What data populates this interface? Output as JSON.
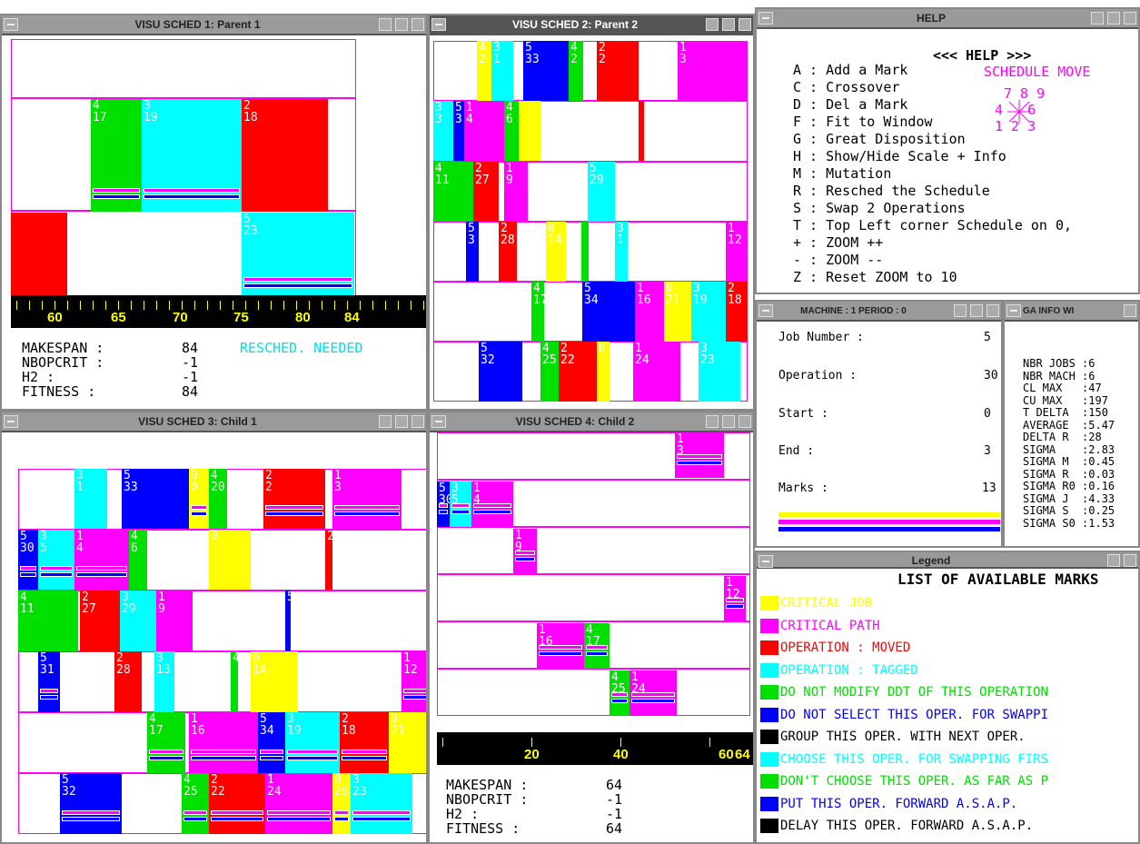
{
  "windows": {
    "w1": "VISU SCHED 1: Parent 1",
    "w2": "VISU SCHED 2: Parent 2",
    "w3": "VISU SCHED 3: Child 1",
    "w4": "VISU SCHED 4: Child 2",
    "help": "HELP",
    "machine": "MACHINE : 1 PERIOD : 0",
    "gainfo": "GA INFO WI",
    "legend": "Legend"
  },
  "s1": {
    "ticks": [
      "60",
      "65",
      "70",
      "75",
      "80",
      "84"
    ],
    "makespan_label": "MAKESPAN :",
    "makespan": "84",
    "nbop_label": "NBOPCRIT :",
    "nbop": "-1",
    "h2_label": "H2 :",
    "h2": "-1",
    "fit_label": "FITNESS :",
    "fit": "84",
    "resched": "RESCHED. NEEDED"
  },
  "s4": {
    "ticks": [
      "20",
      "40",
      "60",
      "64"
    ],
    "makespan_label": "MAKESPAN :",
    "makespan": "64",
    "nbop_label": "NBOPCRIT :",
    "nbop": "-1",
    "h2_label": "H2 :",
    "h2": "-1",
    "fit_label": "FITNESS :",
    "fit": "64"
  },
  "help": {
    "title": "<<< HELP >>>",
    "items": [
      "A : Add a Mark",
      "C : Crossover",
      "D : Del a Mark",
      "F : Fit to Window",
      "G : Great Disposition",
      "H : Show/Hide Scale + Info",
      "M : Mutation",
      "R : Resched the Schedule",
      "S : Swap 2 Operations",
      "T : Top Left corner Schedule on 0,",
      "+ : ZOOM ++",
      "- : ZOOM --",
      "Z : Reset ZOOM to 10"
    ],
    "move_title": "SCHEDULE MOVE",
    "move_row1": "7 8 9",
    "move_row2": "4   6",
    "move_row3": "1 2 3"
  },
  "machine": {
    "job_label": "Job Number :",
    "job": "5",
    "op_label": "Operation :",
    "op": "30",
    "start_label": "Start :",
    "start": "0",
    "end_label": "End :",
    "end": "3",
    "marks_label": "Marks :",
    "marks": "13"
  },
  "gainfo": {
    "lines": [
      "NBR JOBS :6",
      "NBR MACH :6",
      "CL MAX   :47",
      "CU MAX   :197",
      "T DELTA  :150",
      "AVERAGE  :5.47",
      "DELTA R  :28",
      "SIGMA    :2.83",
      "SIGMA M  :0.45",
      "SIGMA R  :0.03",
      "SIGMA R0 :0.16",
      "SIGMA J  :4.33",
      "SIGMA S  :0.25",
      "SIGMA S0 :1.53"
    ]
  },
  "legend": {
    "title": "LIST OF AVAILABLE MARKS",
    "items": [
      {
        "color": "#ffff00",
        "text": "CRITICAL JOB"
      },
      {
        "color": "#ff00ff",
        "text": "CRITICAL PATH"
      },
      {
        "color": "#ff0000",
        "text": "OPERATION : MOVED"
      },
      {
        "color": "#00ffff",
        "text": "OPERATION : TAGGED"
      },
      {
        "color": "#00e000",
        "text": "DO NOT MODIFY DDT OF THIS OPERATION"
      },
      {
        "color": "#0000ff",
        "text": "DO NOT SELECT THIS OPER. FOR SWAPPI"
      },
      {
        "color": "#000000",
        "text": "GROUP THIS OPER. WITH NEXT OPER."
      },
      {
        "color": "#00ffff",
        "text": "CHOOSE THIS OPER. FOR SWAPPING FIRS"
      },
      {
        "color": "#00e000",
        "text": "DON'T CHOOSE THIS OPER. AS FAR AS P"
      },
      {
        "color": "#0000ff",
        "text": "PUT THIS OPER. FORWARD A.S.A.P."
      },
      {
        "color": "#000000",
        "text": "DELAY THIS OPER. FORWARD A.S.A.P."
      }
    ]
  },
  "sched": {
    "w1": [
      {
        "l": "",
        "c": "#ffffff"
      },
      {
        "l": "4\n17",
        "c": "#00e000",
        "m": 1
      },
      {
        "l": "3\n19",
        "c": "#00ffff",
        "m": 1
      },
      {
        "l": "2\n18",
        "c": "#ff0000"
      },
      {
        "l": "",
        "c": "#ff0000"
      },
      {
        "l": "5\n23",
        "c": "#00ffff",
        "m": 2
      }
    ],
    "w2": [
      {
        "l": "4\n2",
        "c": "#ffff00"
      },
      {
        "l": "3\n1",
        "c": "#00ffff"
      },
      {
        "l": "5\n33",
        "c": "#0000ff"
      },
      {
        "l": "4\n2",
        "c": "#00e000"
      },
      {
        "l": "2\n2",
        "c": "#ff0000"
      },
      {
        "l": "1\n3",
        "c": "#ff00ff"
      },
      {
        "l": "3\n3",
        "c": "#00ffff"
      },
      {
        "l": "5\n3",
        "c": "#0000ff"
      },
      {
        "l": "1\n4",
        "c": "#ff00ff"
      },
      {
        "l": "4\n6",
        "c": "#00e000"
      },
      {
        "l": "",
        "c": "#ffff00"
      },
      {
        "l": "",
        "c": "#ff0000"
      },
      {
        "l": "4\n11",
        "c": "#00e000"
      },
      {
        "l": "2\n27",
        "c": "#ff0000"
      },
      {
        "l": "1\n9",
        "c": "#ff00ff"
      },
      {
        "l": "5\n29",
        "c": "#00ffff"
      },
      {
        "l": "5\n3",
        "c": "#0000ff"
      },
      {
        "l": "2\n28",
        "c": "#ff0000"
      },
      {
        "l": "0\n14",
        "c": "#ffff00"
      },
      {
        "l": "",
        "c": "#00e000"
      },
      {
        "l": "3\n1",
        "c": "#00ffff"
      },
      {
        "l": "1\n12",
        "c": "#ff00ff"
      },
      {
        "l": "4\n17",
        "c": "#00e000"
      },
      {
        "l": "5\n34",
        "c": "#0000ff"
      },
      {
        "l": "1\n16",
        "c": "#ff00ff"
      },
      {
        "l": "0\n21",
        "c": "#ffff00"
      },
      {
        "l": "3\n19",
        "c": "#00ffff"
      },
      {
        "l": "2\n18",
        "c": "#ff0000"
      },
      {
        "l": "5\n32",
        "c": "#0000ff"
      },
      {
        "l": "4\n25",
        "c": "#00e000"
      },
      {
        "l": "2\n22",
        "c": "#ff0000"
      },
      {
        "l": "0",
        "c": "#ffff00"
      },
      {
        "l": "1\n24",
        "c": "#ff00ff"
      },
      {
        "l": "3\n23",
        "c": "#00ffff"
      }
    ],
    "w3": [
      {
        "l": "3\n1",
        "c": "#00ffff"
      },
      {
        "l": "5\n33",
        "c": "#0000ff"
      },
      {
        "l": "0\n0",
        "c": "#ffff00"
      },
      {
        "l": "4\n20",
        "c": "#00e000"
      },
      {
        "l": "2\n2",
        "c": "#ff0000"
      },
      {
        "l": "1\n3",
        "c": "#ff00ff"
      },
      {
        "l": "5\n30",
        "c": "#0000ff"
      },
      {
        "l": "3\n5",
        "c": "#00ffff"
      },
      {
        "l": "1\n4",
        "c": "#ff00ff"
      },
      {
        "l": "4\n6",
        "c": "#00e000"
      },
      {
        "l": "0",
        "c": "#ffff00"
      },
      {
        "l": "2",
        "c": "#ff0000"
      },
      {
        "l": "4\n11",
        "c": "#00e000"
      },
      {
        "l": "2\n27",
        "c": "#ff0000"
      },
      {
        "l": "3\n29",
        "c": "#00ffff"
      },
      {
        "l": "1\n9",
        "c": "#ff00ff"
      },
      {
        "l": "5",
        "c": "#0000ff"
      },
      {
        "l": "5\n31",
        "c": "#0000ff"
      },
      {
        "l": "2\n28",
        "c": "#ff0000"
      },
      {
        "l": "3\n13",
        "c": "#00ffff"
      },
      {
        "l": "4",
        "c": "#00e000"
      },
      {
        "l": "0\n14",
        "c": "#ffff00"
      },
      {
        "l": "1\n12",
        "c": "#ff00ff"
      },
      {
        "l": "4\n17",
        "c": "#00e000"
      },
      {
        "l": "1\n16",
        "c": "#ff00ff"
      },
      {
        "l": "5\n34",
        "c": "#0000ff"
      },
      {
        "l": "3\n19",
        "c": "#00ffff"
      },
      {
        "l": "2\n18",
        "c": "#ff0000"
      },
      {
        "l": "0\n21",
        "c": "#ffff00"
      },
      {
        "l": "5\n32",
        "c": "#0000ff"
      },
      {
        "l": "4\n25",
        "c": "#00e000"
      },
      {
        "l": "2\n22",
        "c": "#ff0000"
      },
      {
        "l": "1\n24",
        "c": "#ff00ff"
      },
      {
        "l": "0\n26",
        "c": "#ffff00"
      },
      {
        "l": "3\n23",
        "c": "#00ffff"
      }
    ],
    "w4": [
      {
        "l": "1\n3",
        "c": "#ff00ff"
      },
      {
        "l": "5\n30",
        "c": "#0000ff"
      },
      {
        "l": "3\n5",
        "c": "#00ffff"
      },
      {
        "l": "1\n4",
        "c": "#ff00ff"
      },
      {
        "l": "1\n9",
        "c": "#ff00ff"
      },
      {
        "l": "1\n12",
        "c": "#ff00ff"
      },
      {
        "l": "1\n16",
        "c": "#ff00ff"
      },
      {
        "l": "4\n17",
        "c": "#00e000"
      },
      {
        "l": "4\n25",
        "c": "#00e000"
      },
      {
        "l": "1\n24",
        "c": "#ff00ff"
      }
    ]
  }
}
